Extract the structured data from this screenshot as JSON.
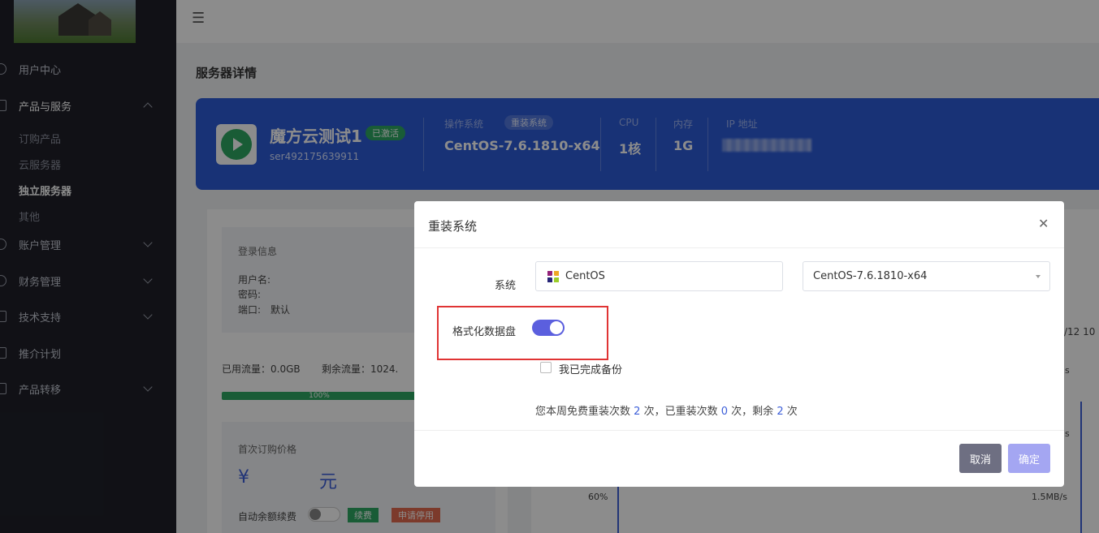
{
  "sidebar": {
    "menu": [
      {
        "label": "用户中心",
        "icon": "home-icon"
      },
      {
        "label": "产品与服务",
        "icon": "grid-icon",
        "expanded": true
      },
      {
        "label": "账户管理",
        "icon": "user-icon"
      },
      {
        "label": "财务管理",
        "icon": "finance-icon"
      },
      {
        "label": "技术支持",
        "icon": "support-icon"
      },
      {
        "label": "推介计划",
        "icon": "share-icon"
      },
      {
        "label": "产品转移",
        "icon": "transfer-icon"
      }
    ],
    "sub_items": [
      "订购产品",
      "云服务器",
      "独立服务器",
      "其他"
    ],
    "active_sub": "独立服务器"
  },
  "header": {
    "menu_icon": "hamburger-icon"
  },
  "page": {
    "title": "服务器详情"
  },
  "server": {
    "name": "魔方云测试1",
    "status": "已激活",
    "sn": "ser492175639911",
    "os_label": "操作系统",
    "reinstall_chip": "重装系统",
    "os_value": "CentOS-7.6.1810-x64",
    "cpu_label": "CPU",
    "cpu_value": "1核",
    "mem_label": "内存",
    "mem_value": "1G",
    "ip_label": "IP 地址"
  },
  "login": {
    "title": "登录信息",
    "username_label": "用户名:",
    "password_label": "密码:",
    "port_label": "端口:",
    "port_value": "默认"
  },
  "traffic": {
    "used": "已用流量：0.0GB",
    "remain": "剩余流量：1024.",
    "percent_text": "100%"
  },
  "pricing": {
    "title": "首次订购价格",
    "currency": "¥",
    "unit": "元",
    "auto_renew_label": "自动余额续费",
    "renew_tag": "续费",
    "stop_tag": "申请停用"
  },
  "chart_bg": {
    "tick_left": "60%",
    "tick_right": "1.5MB/s",
    "date_fragment": "/12 10",
    "s1": "s",
    "s2": "s"
  },
  "dialog": {
    "title": "重装系统",
    "system_label": "系统",
    "os_family": "CentOS",
    "os_version": "CentOS-7.6.1810-x64",
    "format_label": "格式化数据盘",
    "format_enabled": true,
    "backup_label": "我已完成备份",
    "quota_prefix": "您本周免费重装次数",
    "quota_free": "2",
    "quota_mid1": "次，已重装次数",
    "quota_used": "0",
    "quota_mid2": "次，剩余",
    "quota_remain": "2",
    "quota_suffix": "次",
    "cancel_label": "取消",
    "confirm_label": "确定"
  },
  "colors": {
    "banner": "#2c5bd8",
    "accent": "#5b5fde",
    "success": "#2ea863",
    "highlight": "#e03434",
    "sidebar": "#1f2029"
  }
}
